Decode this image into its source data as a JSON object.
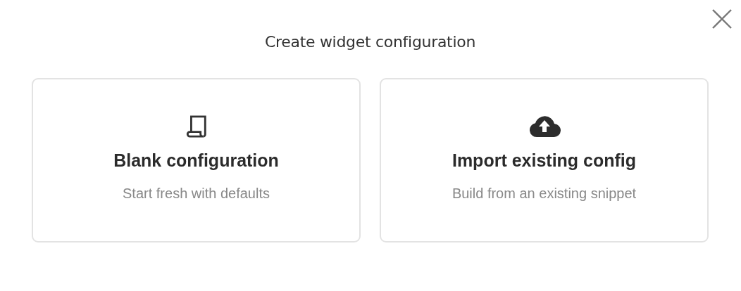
{
  "dialog": {
    "title": "Create widget configuration",
    "options": [
      {
        "kind": "scroll",
        "title": "Blank configuration",
        "description": "Start fresh with defaults"
      },
      {
        "kind": "upload",
        "title": "Import existing config",
        "description": "Build from an existing snippet"
      }
    ]
  }
}
